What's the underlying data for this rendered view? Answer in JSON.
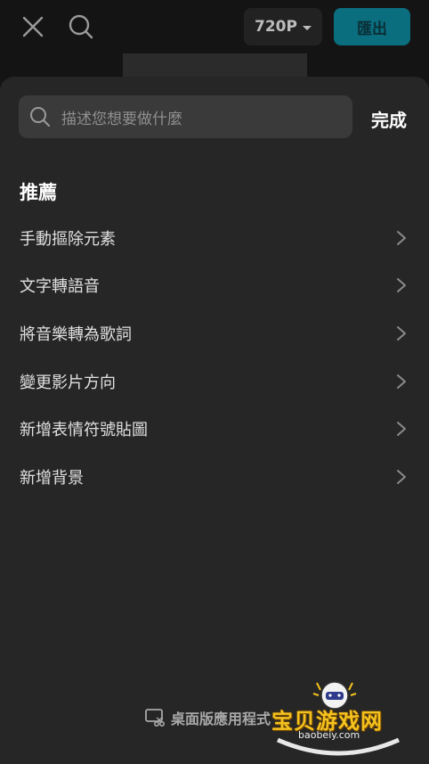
{
  "toolbar": {
    "resolution": "720P",
    "export_label": "匯出"
  },
  "sheet": {
    "search_placeholder": "描述您想要做什麼",
    "done_label": "完成",
    "section_title": "推薦",
    "items": [
      {
        "label": "手動摳除元素"
      },
      {
        "label": "文字轉語音"
      },
      {
        "label": "將音樂轉為歌詞"
      },
      {
        "label": "變更影片方向"
      },
      {
        "label": "新增表情符號貼圖"
      },
      {
        "label": "新增背景"
      }
    ],
    "footer_label": "桌面版應用程式"
  },
  "watermark": {
    "title": "宝贝游戏网",
    "url": "baobeiy.com"
  },
  "icons": {
    "close": "close-icon",
    "search": "search-icon",
    "chevron": "chevron-right-icon",
    "desktop": "desktop-scissors-icon"
  },
  "colors": {
    "background": "#141414",
    "sheet": "#262626",
    "search_field": "#3a3a3a",
    "export_accent": "#0b6e7e"
  }
}
